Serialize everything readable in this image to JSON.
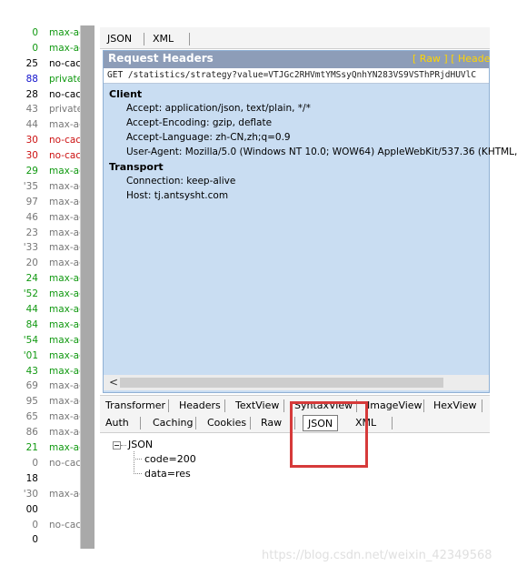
{
  "sessions": [
    {
      "num": "0",
      "cache": "max-ag",
      "num_color": "green",
      "cache_color": "green"
    },
    {
      "num": "0",
      "cache": "max-ag",
      "num_color": "green",
      "cache_color": "green"
    },
    {
      "num": "25",
      "cache": "no-cac",
      "num_color": "black",
      "cache_color": "black"
    },
    {
      "num": "88",
      "cache": "private",
      "num_color": "blue",
      "cache_color": "green"
    },
    {
      "num": "28",
      "cache": "no-cac",
      "num_color": "black",
      "cache_color": "black"
    },
    {
      "num": "43",
      "cache": "private",
      "num_color": "gray",
      "cache_color": "gray"
    },
    {
      "num": "44",
      "cache": "max-ag",
      "num_color": "gray",
      "cache_color": "gray"
    },
    {
      "num": "30",
      "cache": "no-cac",
      "num_color": "red",
      "cache_color": "red"
    },
    {
      "num": "30",
      "cache": "no-cac",
      "num_color": "red",
      "cache_color": "red"
    },
    {
      "num": "29",
      "cache": "max-ag",
      "num_color": "green",
      "cache_color": "green"
    },
    {
      "num": "'35",
      "cache": "max-ag",
      "num_color": "gray",
      "cache_color": "gray"
    },
    {
      "num": "97",
      "cache": "max-ag",
      "num_color": "gray",
      "cache_color": "gray"
    },
    {
      "num": "46",
      "cache": "max-ag",
      "num_color": "gray",
      "cache_color": "gray"
    },
    {
      "num": "23",
      "cache": "max-ag",
      "num_color": "gray",
      "cache_color": "gray"
    },
    {
      "num": "'33",
      "cache": "max-ag",
      "num_color": "gray",
      "cache_color": "gray"
    },
    {
      "num": "20",
      "cache": "max-ag",
      "num_color": "gray",
      "cache_color": "gray"
    },
    {
      "num": "24",
      "cache": "max-ag",
      "num_color": "green",
      "cache_color": "green"
    },
    {
      "num": "'52",
      "cache": "max-ag",
      "num_color": "green",
      "cache_color": "green"
    },
    {
      "num": "44",
      "cache": "max-ag",
      "num_color": "green",
      "cache_color": "green"
    },
    {
      "num": "84",
      "cache": "max-ag",
      "num_color": "green",
      "cache_color": "green"
    },
    {
      "num": "'54",
      "cache": "max-ag",
      "num_color": "green",
      "cache_color": "green"
    },
    {
      "num": "'01",
      "cache": "max-ag",
      "num_color": "green",
      "cache_color": "green"
    },
    {
      "num": "43",
      "cache": "max-ag",
      "num_color": "green",
      "cache_color": "green"
    },
    {
      "num": "69",
      "cache": "max-ag",
      "num_color": "gray",
      "cache_color": "gray"
    },
    {
      "num": "95",
      "cache": "max-ag",
      "num_color": "gray",
      "cache_color": "gray"
    },
    {
      "num": "65",
      "cache": "max-ag",
      "num_color": "gray",
      "cache_color": "gray"
    },
    {
      "num": "86",
      "cache": "max-ag",
      "num_color": "gray",
      "cache_color": "gray"
    },
    {
      "num": "21",
      "cache": "max-ag",
      "num_color": "green",
      "cache_color": "green"
    },
    {
      "num": "0",
      "cache": "no-cac",
      "num_color": "gray",
      "cache_color": "gray"
    },
    {
      "num": "18",
      "cache": "",
      "num_color": "black",
      "cache_color": "black"
    },
    {
      "num": "'30",
      "cache": "max-ag",
      "num_color": "gray",
      "cache_color": "gray"
    },
    {
      "num": "00",
      "cache": "",
      "num_color": "black",
      "cache_color": "black"
    },
    {
      "num": "0",
      "cache": "no-cac",
      "num_color": "gray",
      "cache_color": "gray"
    },
    {
      "num": "0",
      "cache": "",
      "num_color": "black",
      "cache_color": "black"
    }
  ],
  "request": {
    "tabs": [
      "JSON",
      "XML"
    ],
    "header_title": "Request Headers",
    "header_links": "[ Raw ]    [ Heade",
    "url": "GET /statistics/strategy?value=VTJGc2RHVmtYMSsyQnhYN283VS9VSThPRjdHUVlC",
    "groups": [
      {
        "name": "Client",
        "lines": [
          "Accept: application/json, text/plain, */*",
          "Accept-Encoding: gzip, deflate",
          "Accept-Language: zh-CN,zh;q=0.9",
          "User-Agent: Mozilla/5.0 (Windows NT 10.0; WOW64) AppleWebKit/537.36 (KHTML,"
        ]
      },
      {
        "name": "Transport",
        "lines": [
          "Connection: keep-alive",
          "Host: tj.antsysht.com"
        ]
      }
    ],
    "scroll_arrow": "<"
  },
  "response": {
    "tabs_row1": [
      "Transformer",
      "Headers",
      "TextView",
      "SyntaxView",
      "ImageView",
      "HexView"
    ],
    "tabs_row2": [
      "Auth",
      "Caching",
      "Cookies",
      "Raw",
      "JSON",
      "XML"
    ],
    "active_tab": "JSON",
    "tree": {
      "root": "JSON",
      "children": [
        "code=200",
        "data=res"
      ]
    }
  },
  "watermark": "https://blog.csdn.net/weixin_42349568",
  "colors": {
    "green": "#119911",
    "gray": "#777777",
    "black": "#000000",
    "red": "#cc1111",
    "blue": "#1111cc",
    "highlight": "#d63a3a"
  }
}
